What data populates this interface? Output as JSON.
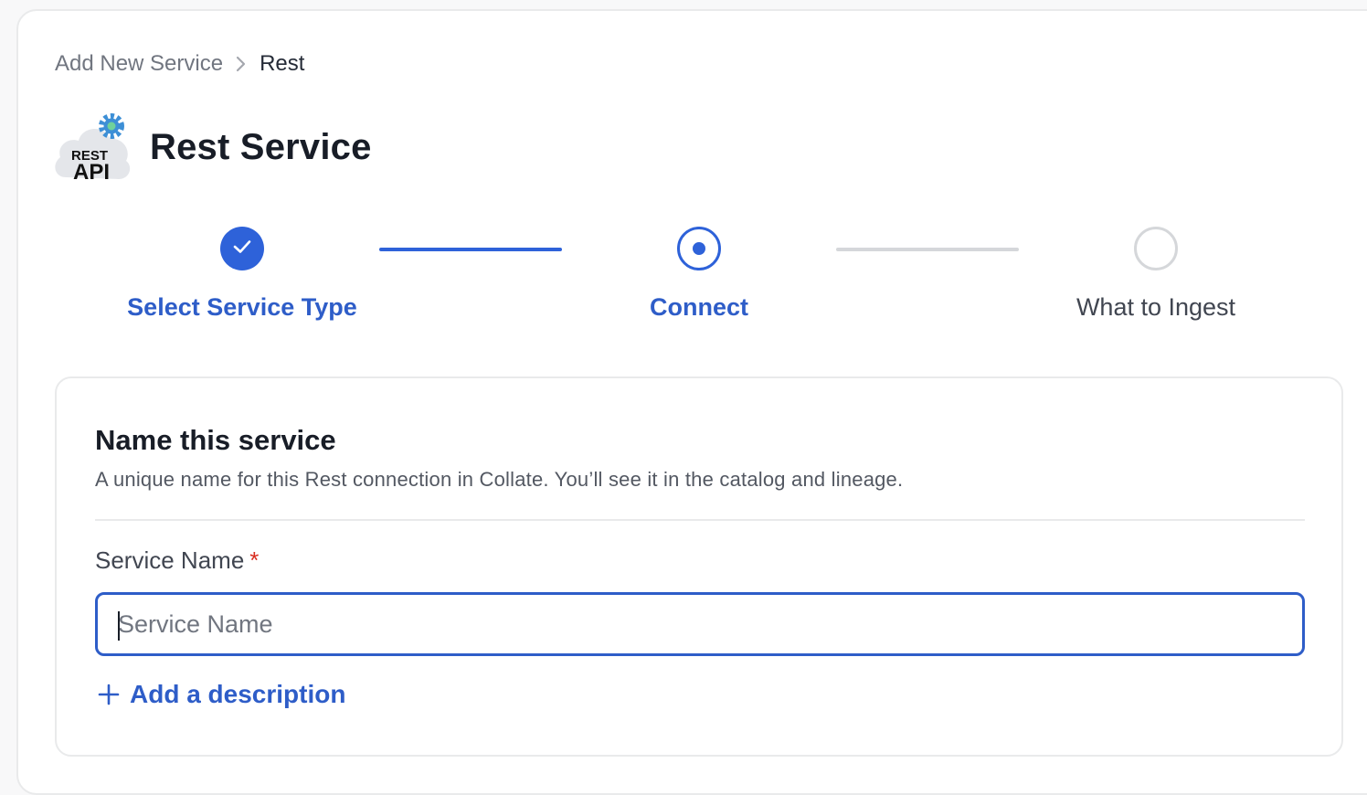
{
  "breadcrumb": {
    "parent": "Add New Service",
    "current": "Rest"
  },
  "header": {
    "logo_line1": "REST",
    "logo_line2": "API",
    "title": "Rest Service"
  },
  "stepper": {
    "steps": [
      {
        "label": "Select Service Type",
        "state": "done"
      },
      {
        "label": "Connect",
        "state": "active"
      },
      {
        "label": "What to Ingest",
        "state": "todo"
      }
    ]
  },
  "form": {
    "section_title": "Name this service",
    "section_desc": "A unique name for this Rest connection in Collate. You’ll see it in the catalog and lineage.",
    "field_label": "Service Name",
    "required_mark": "*",
    "input_value": "",
    "input_placeholder": "Service Name",
    "add_description_label": "Add a description"
  },
  "colors": {
    "accent": "#2e62d9",
    "link": "#2e5dc8",
    "required": "#d92d20",
    "inactive": "#d5d7da"
  },
  "icons": {
    "breadcrumb_separator": "chevron-right-icon",
    "step_done": "check-icon",
    "add": "plus-icon",
    "logo": "rest-api-cloud-icon"
  }
}
